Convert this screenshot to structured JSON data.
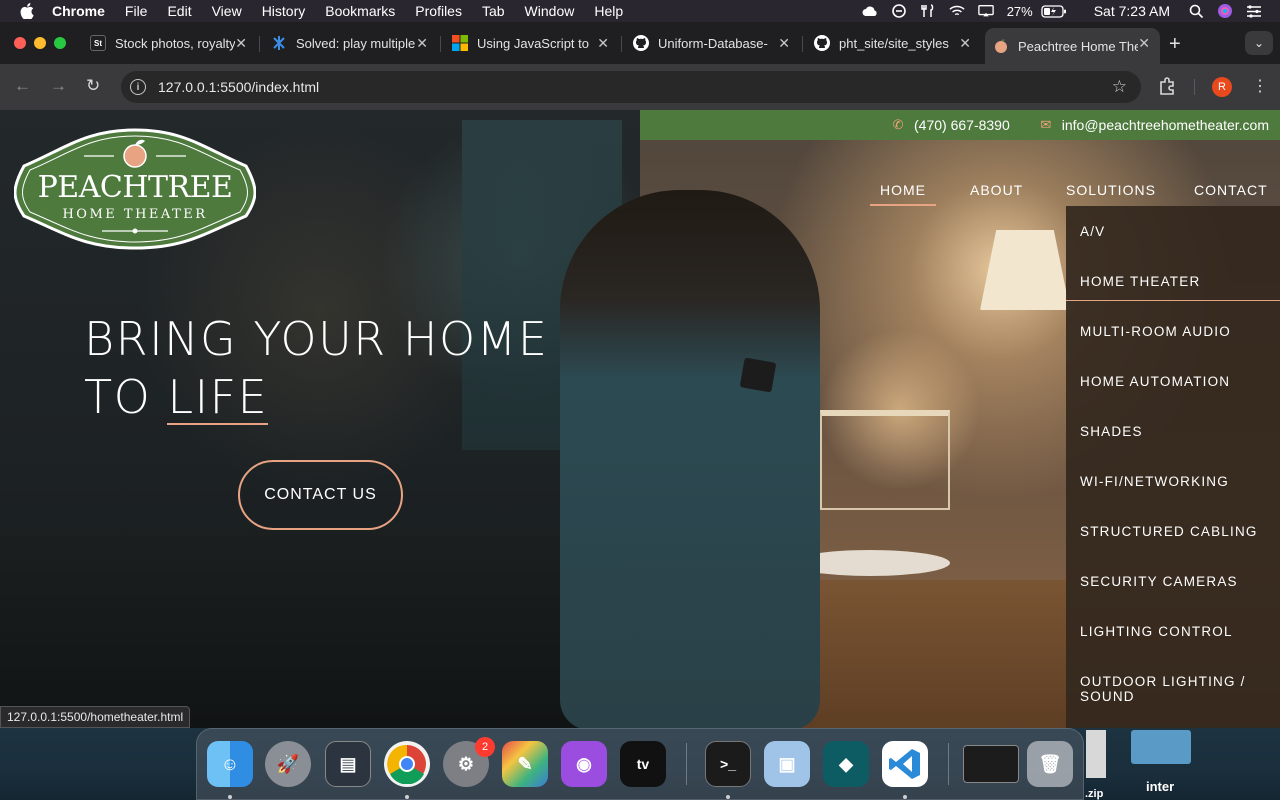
{
  "menubar": {
    "app_name": "Chrome",
    "items": [
      "File",
      "Edit",
      "View",
      "History",
      "Bookmarks",
      "Profiles",
      "Tab",
      "Window",
      "Help"
    ],
    "battery": "27%",
    "clock": "Sat 7:23 AM"
  },
  "tabs": [
    {
      "title": "Stock photos, royalty",
      "favicon": "St",
      "color": "#1f1f22",
      "active": false
    },
    {
      "title": "Solved: play multiple",
      "favicon": "",
      "color": "#2f7fe0",
      "active": false
    },
    {
      "title": "Using JavaScript to",
      "favicon": "",
      "color": "#f25022",
      "active": false
    },
    {
      "title": "Uniform-Database-",
      "favicon": "",
      "color": "#ffffff",
      "active": false
    },
    {
      "title": "pht_site/site_styles",
      "favicon": "",
      "color": "#ffffff",
      "active": false
    },
    {
      "title": "Peachtree Home Theater",
      "favicon": "",
      "color": "#e8a383",
      "active": true
    }
  ],
  "toolbar": {
    "url": "127.0.0.1:5500/index.html",
    "profile_initial": "R"
  },
  "site": {
    "phone": "(470) 667-8390",
    "email": "info@peachtreehometheater.com",
    "logo_main": "PEACHTREE",
    "logo_sub": "HOME THEATER",
    "nav": {
      "home": "HOME",
      "about": "ABOUT",
      "solutions": "SOLUTIONS",
      "contact": "CONTACT"
    },
    "dropdown": [
      "A/V",
      "HOME THEATER",
      "MULTI-ROOM AUDIO",
      "HOME AUTOMATION",
      "SHADES",
      "WI-FI/NETWORKING",
      "STRUCTURED CABLING",
      "SECURITY CAMERAS",
      "LIGHTING CONTROL",
      "OUTDOOR LIGHTING / SOUND"
    ],
    "hero_line1": "BRING YOUR HOME",
    "hero_line2_prefix": "TO",
    "hero_line2_word": "LIFE",
    "cta": "CONTACT US"
  },
  "status_url": "127.0.0.1:5500/hometheater.html",
  "dock": {
    "items": [
      "finder",
      "launchpad",
      "preview",
      "chrome",
      "system-settings",
      "color-picker",
      "podcasts",
      "apple-tv",
      "terminal",
      "preview-photos",
      "filmora",
      "vscode",
      "window-preview",
      "trash"
    ],
    "settings_badge": "2"
  },
  "desktop": {
    "zip_label": ".zip",
    "folder_label": "inter"
  },
  "colors": {
    "accent_peach": "#e8a383",
    "brand_green": "#4e7a3e"
  }
}
